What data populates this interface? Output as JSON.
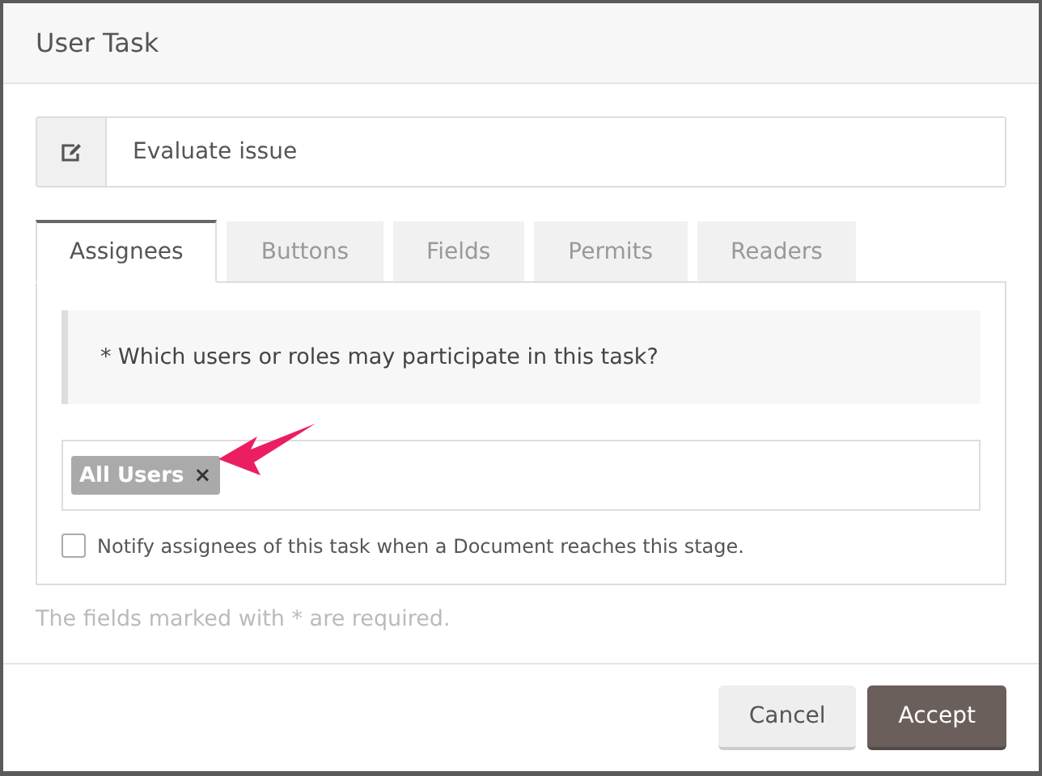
{
  "window": {
    "title": "User Task"
  },
  "task_name": {
    "value": "Evaluate issue"
  },
  "tabs": [
    {
      "label": "Assignees",
      "selected": true
    },
    {
      "label": "Buttons",
      "selected": false
    },
    {
      "label": "Fields",
      "selected": false
    },
    {
      "label": "Permits",
      "selected": false
    },
    {
      "label": "Readers",
      "selected": false
    }
  ],
  "question": "* Which users or roles may participate in this task?",
  "assignees": [
    {
      "label": "All Users",
      "remove": "×"
    }
  ],
  "notify": {
    "label": "Notify assignees of this task when a Document reaches this stage.",
    "checked": false
  },
  "required_note": "The fields marked with * are required.",
  "buttons": [
    {
      "label": "Cancel",
      "kind": "secondary"
    },
    {
      "label": "Accept",
      "kind": "primary"
    }
  ]
}
